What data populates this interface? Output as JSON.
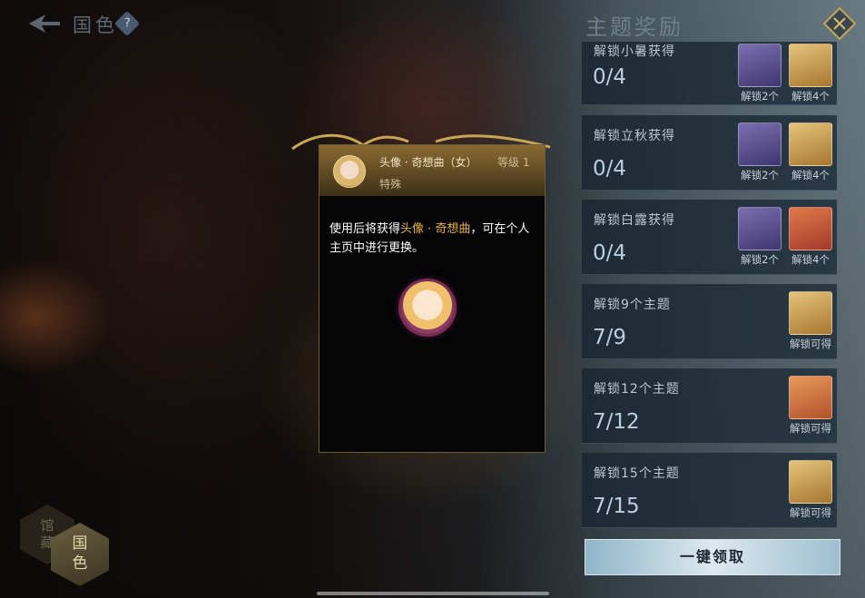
{
  "header": {
    "title": "国色",
    "help_symbol": "?"
  },
  "panel": {
    "title": "主题奖励",
    "claim_all_label": "一键领取"
  },
  "cards": [
    {
      "title": "解锁小暑获得",
      "progress": "0/4",
      "rewards": [
        {
          "kind": "figure",
          "label": "解锁2个"
        },
        {
          "kind": "avatar",
          "label": "解锁4个"
        }
      ]
    },
    {
      "title": "解锁立秋获得",
      "progress": "0/4",
      "rewards": [
        {
          "kind": "figure",
          "label": "解锁2个"
        },
        {
          "kind": "avatar",
          "label": "解锁4个"
        }
      ]
    },
    {
      "title": "解锁白露获得",
      "progress": "0/4",
      "rewards": [
        {
          "kind": "figure",
          "label": "解锁2个"
        },
        {
          "kind": "avatar",
          "label": "解锁4个"
        }
      ]
    },
    {
      "title": "解锁9个主题",
      "progress": "7/9",
      "rewards": [
        {
          "kind": "avatar",
          "label": "解锁可得"
        }
      ]
    },
    {
      "title": "解锁12个主题",
      "progress": "7/12",
      "rewards": [
        {
          "kind": "avatar",
          "label": "解锁可得"
        }
      ]
    },
    {
      "title": "解锁15个主题",
      "progress": "7/15",
      "rewards": [
        {
          "kind": "avatar",
          "label": "解锁可得"
        }
      ]
    }
  ],
  "tooltip": {
    "name": "头像 · 奇想曲（女）",
    "level": "等级 1",
    "tag": "特殊",
    "desc_prefix": "使用后将获得",
    "desc_highlight": "头像 · 奇想曲",
    "desc_suffix": "，可在个人主页中进行更换。"
  },
  "tabs": {
    "inactive": "馆藏",
    "active": "国色"
  },
  "colors": {
    "gold_accent": "#c6a858",
    "highlight": "#e8b33d",
    "card_bg": "#1c2832"
  }
}
